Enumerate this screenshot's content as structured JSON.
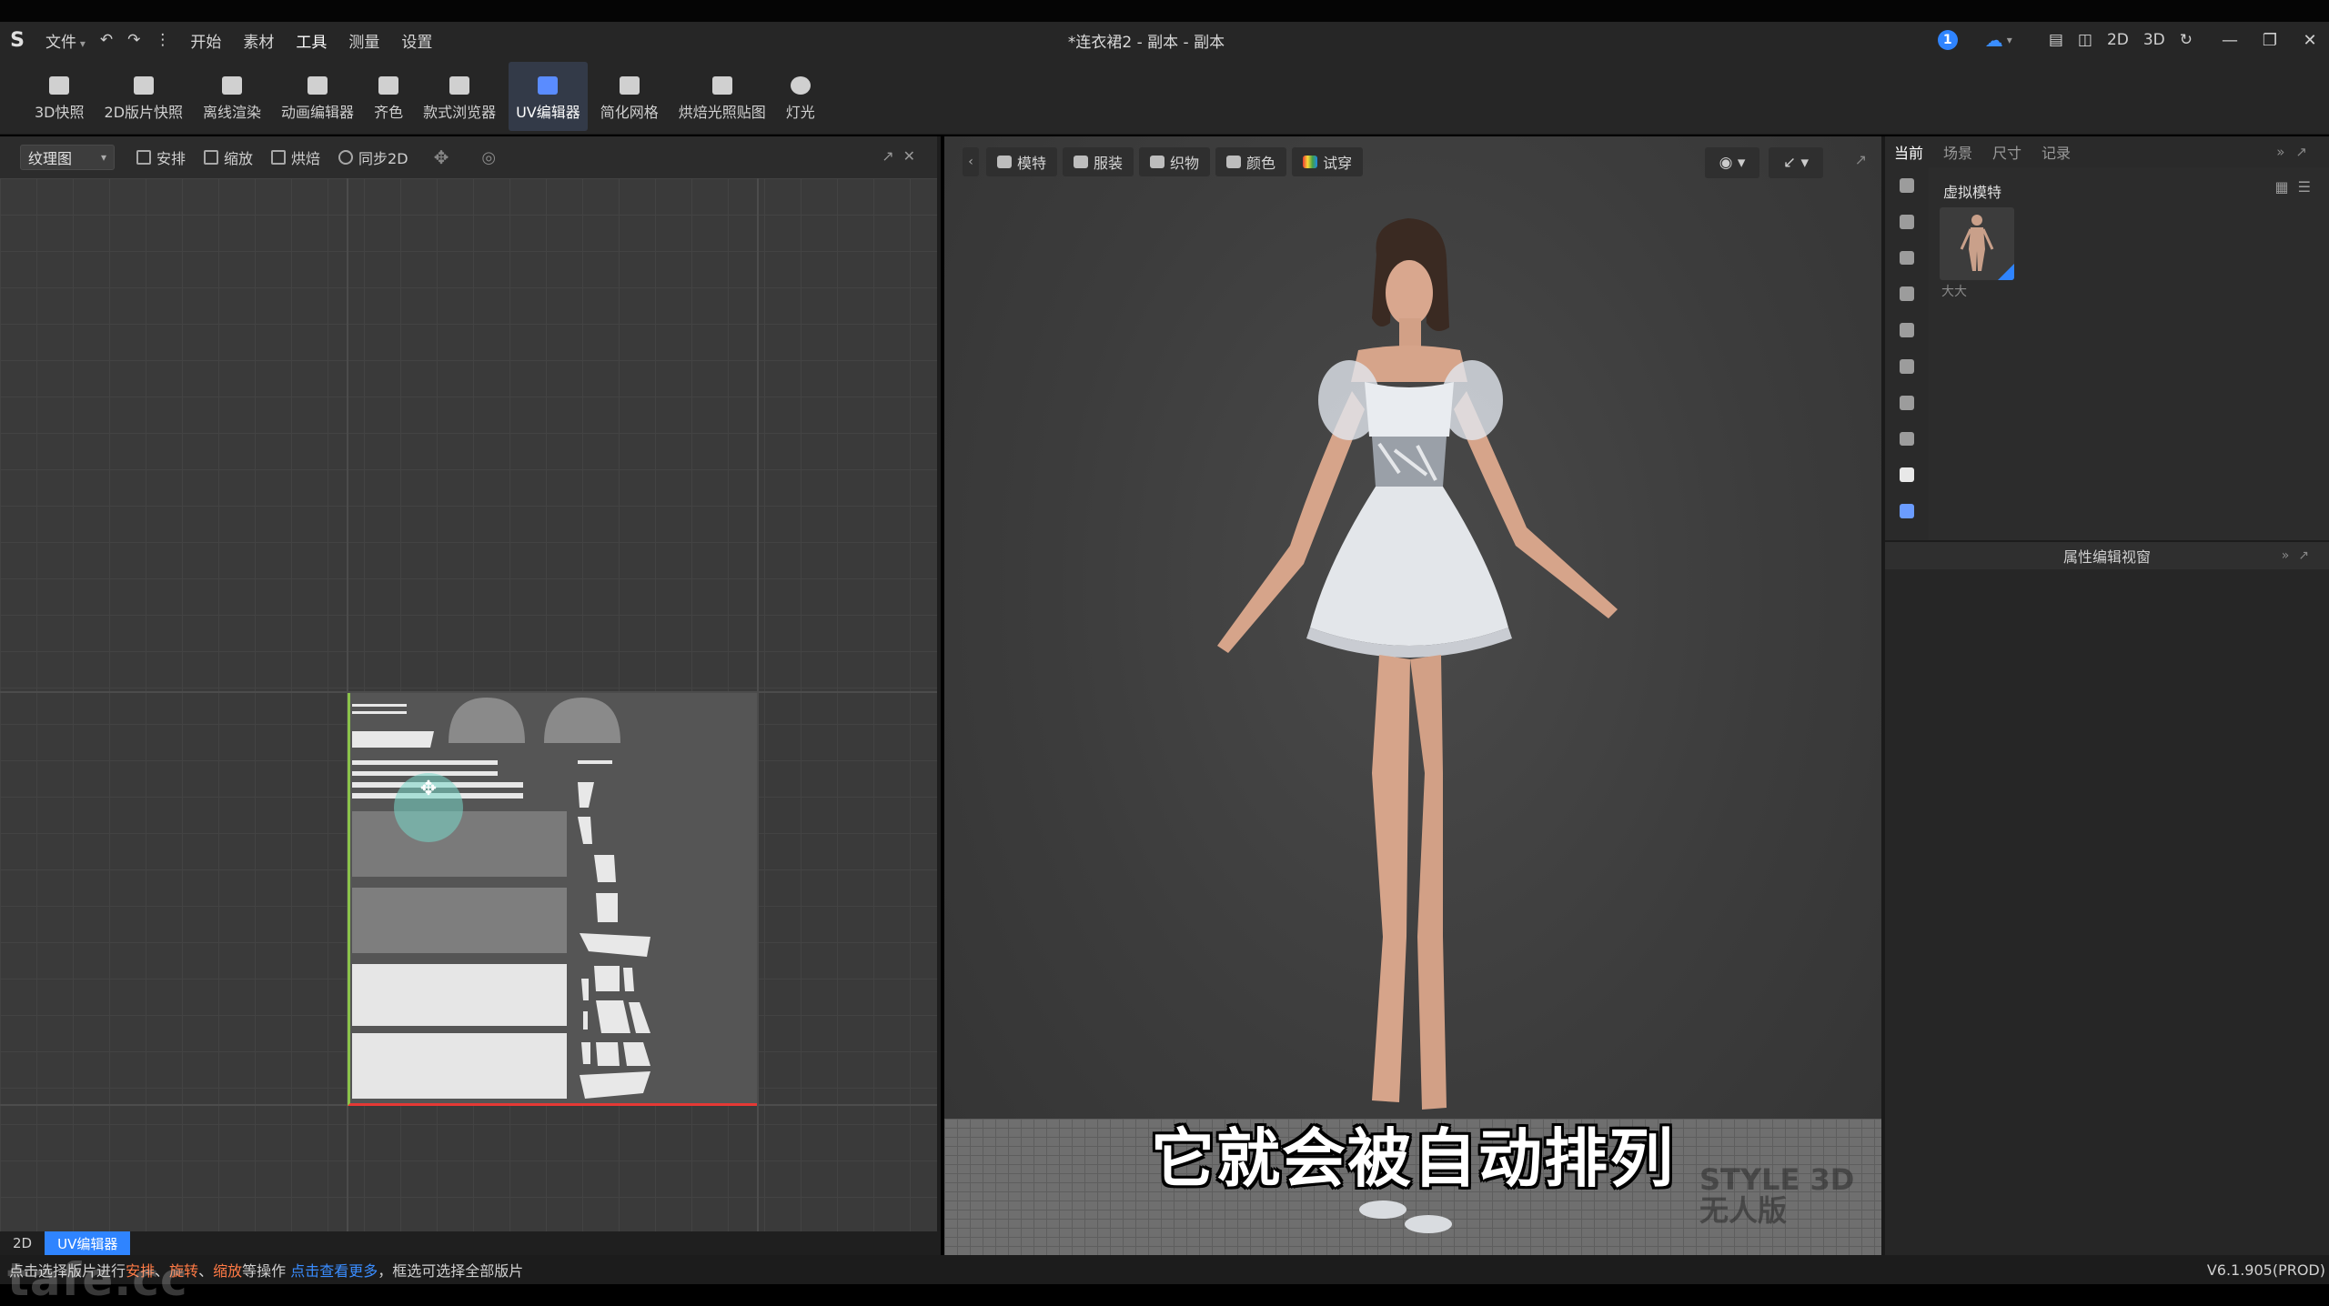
{
  "app": {
    "title": "*连衣裙2 - 副本 - 副本",
    "logo_icon": "style3d-logo-icon"
  },
  "menu": {
    "file": "文件",
    "start": "开始",
    "material": "素材",
    "tools": "工具",
    "measure": "测量",
    "settings": "设置"
  },
  "titlebar_right": {
    "notification_count": "1",
    "mode_2d": "2D",
    "mode_3d": "3D"
  },
  "ribbon": {
    "tools": [
      {
        "label": "3D快照",
        "icon": "camera-icon"
      },
      {
        "label": "2D版片快照",
        "icon": "pattern-snapshot-icon"
      },
      {
        "label": "离线渲染",
        "icon": "render-icon"
      },
      {
        "label": "动画编辑器",
        "icon": "animation-icon"
      },
      {
        "label": "齐色",
        "icon": "colorway-icon"
      },
      {
        "label": "款式浏览器",
        "icon": "style-browser-icon"
      },
      {
        "label": "UV编辑器",
        "icon": "uv-editor-icon",
        "active": true
      },
      {
        "label": "简化网格",
        "icon": "simplify-mesh-icon"
      },
      {
        "label": "烘焙光照贴图",
        "icon": "bake-lightmap-icon"
      },
      {
        "label": "灯光",
        "icon": "light-icon"
      }
    ]
  },
  "uv_panel": {
    "view_select": "纹理图",
    "buttons": [
      {
        "label": "安排",
        "icon": "arrange-icon"
      },
      {
        "label": "缩放",
        "icon": "scale-icon"
      },
      {
        "label": "烘焙",
        "icon": "bake-icon"
      },
      {
        "label": "同步2D",
        "icon": "sync-2d-icon"
      }
    ],
    "footer_tabs": [
      "2D",
      "UV编辑器"
    ]
  },
  "viewport": {
    "toolbar": [
      {
        "label": "模特",
        "icon": "avatar-icon"
      },
      {
        "label": "服装",
        "icon": "garment-icon"
      },
      {
        "label": "织物",
        "icon": "fabric-icon"
      },
      {
        "label": "颜色",
        "icon": "color-icon"
      },
      {
        "label": "试穿",
        "icon": "fitting-icon"
      }
    ],
    "subtitle": "它就会被自动排列",
    "watermark_line1": "STYLE 3D",
    "watermark_line2": "无人版"
  },
  "right_panel": {
    "tabs": [
      "当前",
      "场景",
      "尺寸",
      "记录"
    ],
    "section_title": "虚拟模特",
    "avatar_name": "大大",
    "property_title": "属性编辑视窗"
  },
  "status": {
    "text_prefix": "点击选择版片进行",
    "op1": "安排",
    "sep1": "、",
    "op2": "旋转",
    "sep2": "、",
    "op3": "缩放",
    "text_mid": "等操作",
    "link": "点击查看更多",
    "text_suffix": "，框选可选择全部版片",
    "version": "V6.1.905(PROD)"
  },
  "brand_watermark": "tafe.cc",
  "colors": {
    "accent": "#2f84ff",
    "highlight": "#ff7a45",
    "uv_axis_v": "#8bc34a",
    "uv_axis_h": "#e53935"
  }
}
